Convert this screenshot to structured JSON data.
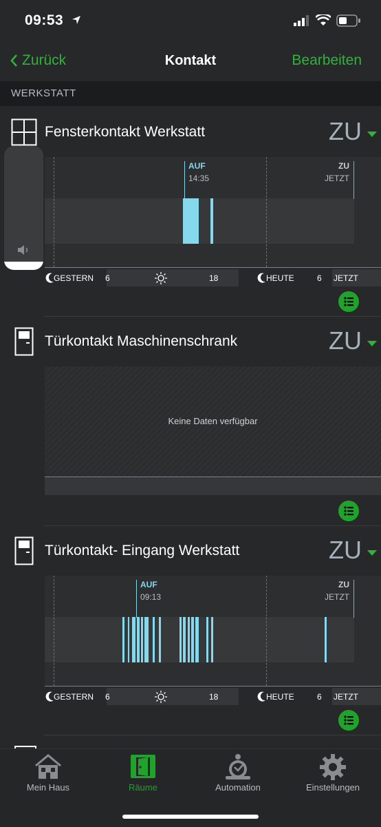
{
  "status": {
    "time": "09:53"
  },
  "nav": {
    "back": "Zurück",
    "title": "Kontakt",
    "edit": "Bearbeiten"
  },
  "section": "WERKSTATT",
  "devices": [
    {
      "title": "Fensterkontakt Werkstatt",
      "state": "ZU",
      "event_label": "AUF",
      "event_time": "14:35",
      "now_label": "ZU",
      "now_time": "JETZT"
    },
    {
      "title": "Türkontakt Maschinenschrank",
      "state": "ZU",
      "no_data": "Keine Daten verfügbar"
    },
    {
      "title": "Türkontakt- Eingang Werkstatt",
      "state": "ZU",
      "event_label": "AUF",
      "event_time": "09:13",
      "now_label": "ZU",
      "now_time": "JETZT"
    }
  ],
  "axis": {
    "yesterday": "GESTERN",
    "six": "6",
    "eighteen": "18",
    "today": "HEUTE",
    "six2": "6",
    "now": "JETZT"
  },
  "tabs": [
    {
      "label": "Mein Haus",
      "icon": "house-icon"
    },
    {
      "label": "Räume",
      "icon": "door-icon",
      "active": true
    },
    {
      "label": "Automation",
      "icon": "automation-icon"
    },
    {
      "label": "Einstellungen",
      "icon": "gear-icon"
    }
  ],
  "colors": {
    "accent": "#2fb33a",
    "bar": "#86d8ec",
    "background": "#262829"
  }
}
